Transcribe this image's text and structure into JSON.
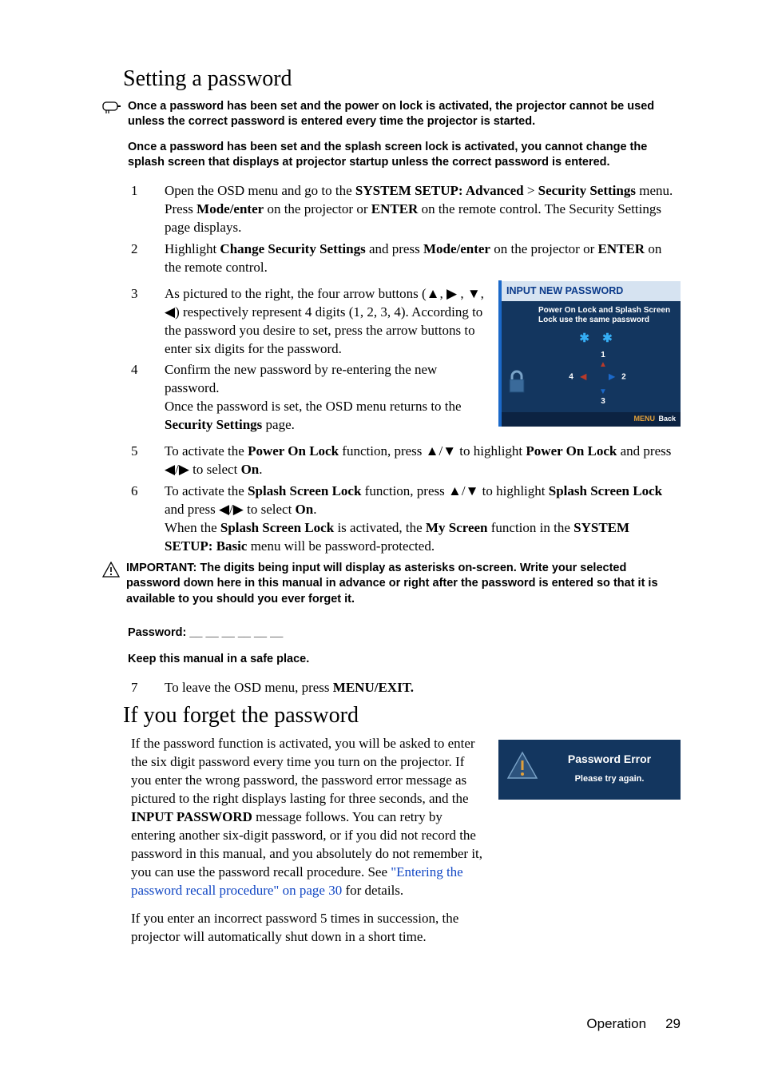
{
  "section1_title": "Setting a password",
  "note1_p1": "Once a password has been set and the power on lock is activated, the projector cannot be used unless the correct password is entered every time the projector is started.",
  "note1_p2": "Once a password has been set and the splash screen lock is activated, you cannot change the splash screen that displays at projector startup unless the correct password is entered.",
  "step1_a": "Open the OSD menu and go to the ",
  "step1_b": "SYSTEM SETUP: Advanced",
  "step1_c": " > ",
  "step1_d": "Security Settings",
  "step1_e": " menu. Press ",
  "step1_f": "Mode/enter",
  "step1_g": " on the projector or ",
  "step1_h": "ENTER",
  "step1_i": " on the remote control. The Security Settings page displays.",
  "step2_a": "Highlight ",
  "step2_b": "Change Security Settings",
  "step2_c": " and press ",
  "step2_d": "Mode/enter",
  "step2_e": " on the projector or ",
  "step2_f": "ENTER",
  "step2_g": " on the remote control.",
  "step3_a": "As pictured to the right, the four arrow buttons (",
  "step3_b": ") respectively represent 4 digits (1, 2, 3, 4). According to the password you desire to set, press the arrow buttons to enter six digits for the password.",
  "step4_a": "Confirm the new password by re-entering the new password.",
  "step4_b": "Once the password is set, the OSD menu returns to the ",
  "step4_c": "Security Settings",
  "step4_d": " page.",
  "step5_a": "To activate the ",
  "step5_b": "Power On Lock",
  "step5_c": " function, press ",
  "step5_d": " to highlight ",
  "step5_e": "Power On Lock",
  "step5_f": " and press ",
  "step5_g": "  to select ",
  "step5_h": "On",
  "step5_i": ".",
  "step6_a": "To activate the ",
  "step6_b": "Splash Screen Lock",
  "step6_c": " function, press ",
  "step6_d": "  to highlight ",
  "step6_e": "Splash Screen Lock",
  "step6_f": " and press ",
  "step6_g": "  to select ",
  "step6_h": "On",
  "step6_i": ".",
  "step6_j": "When the ",
  "step6_k": "Splash Screen Lock",
  "step6_l": " is activated, the ",
  "step6_m": "My Screen",
  "step6_n": " function in the ",
  "step6_o": "SYSTEM SETUP: Basic",
  "step6_p": " menu will be password-protected.",
  "important_text": "IMPORTANT: The digits being input will display as asterisks on-screen. Write your selected password down here in this manual in advance or right after the password is entered so that it is available to you should you ever forget it.",
  "password_line": "Password: __ __ __ __ __ __",
  "keep_line": "Keep this manual in a safe place.",
  "step7_a": "To leave the OSD menu, press ",
  "step7_b": "MENU/EXIT.",
  "section2_title": "If you forget the password",
  "forget_p1_a": "If the password function is activated, you will be asked to enter the six digit password every time you turn on the projector. If you enter the wrong password, the password error message as pictured to the right displays lasting for three seconds, and the ",
  "forget_p1_b": "INPUT PASSWORD",
  "forget_p1_c": " message follows. You can retry by entering another six-digit password, or if you did not record the password in this manual, and you absolutely do not remember it, you can use the password recall procedure. See ",
  "forget_link": "\"Entering the password recall procedure\" on page 30",
  "forget_p1_d": " for details.",
  "forget_p2": "If you enter an incorrect password 5 times in succession, the projector will automatically shut down in a short time.",
  "osd_title": "INPUT NEW PASSWORD",
  "osd_subtitle": "Power On Lock and Splash Screen Lock use the same password",
  "osd_stars": "✱ ✱",
  "osd_menu": "MENU",
  "osd_back": "Back",
  "err_title": "Password Error",
  "err_sub": "Please try again.",
  "footer_section": "Operation",
  "footer_page": "29",
  "n1": "1",
  "n2": "2",
  "n3": "3",
  "n4": "4",
  "n5": "5",
  "n6": "6",
  "n7": "7"
}
